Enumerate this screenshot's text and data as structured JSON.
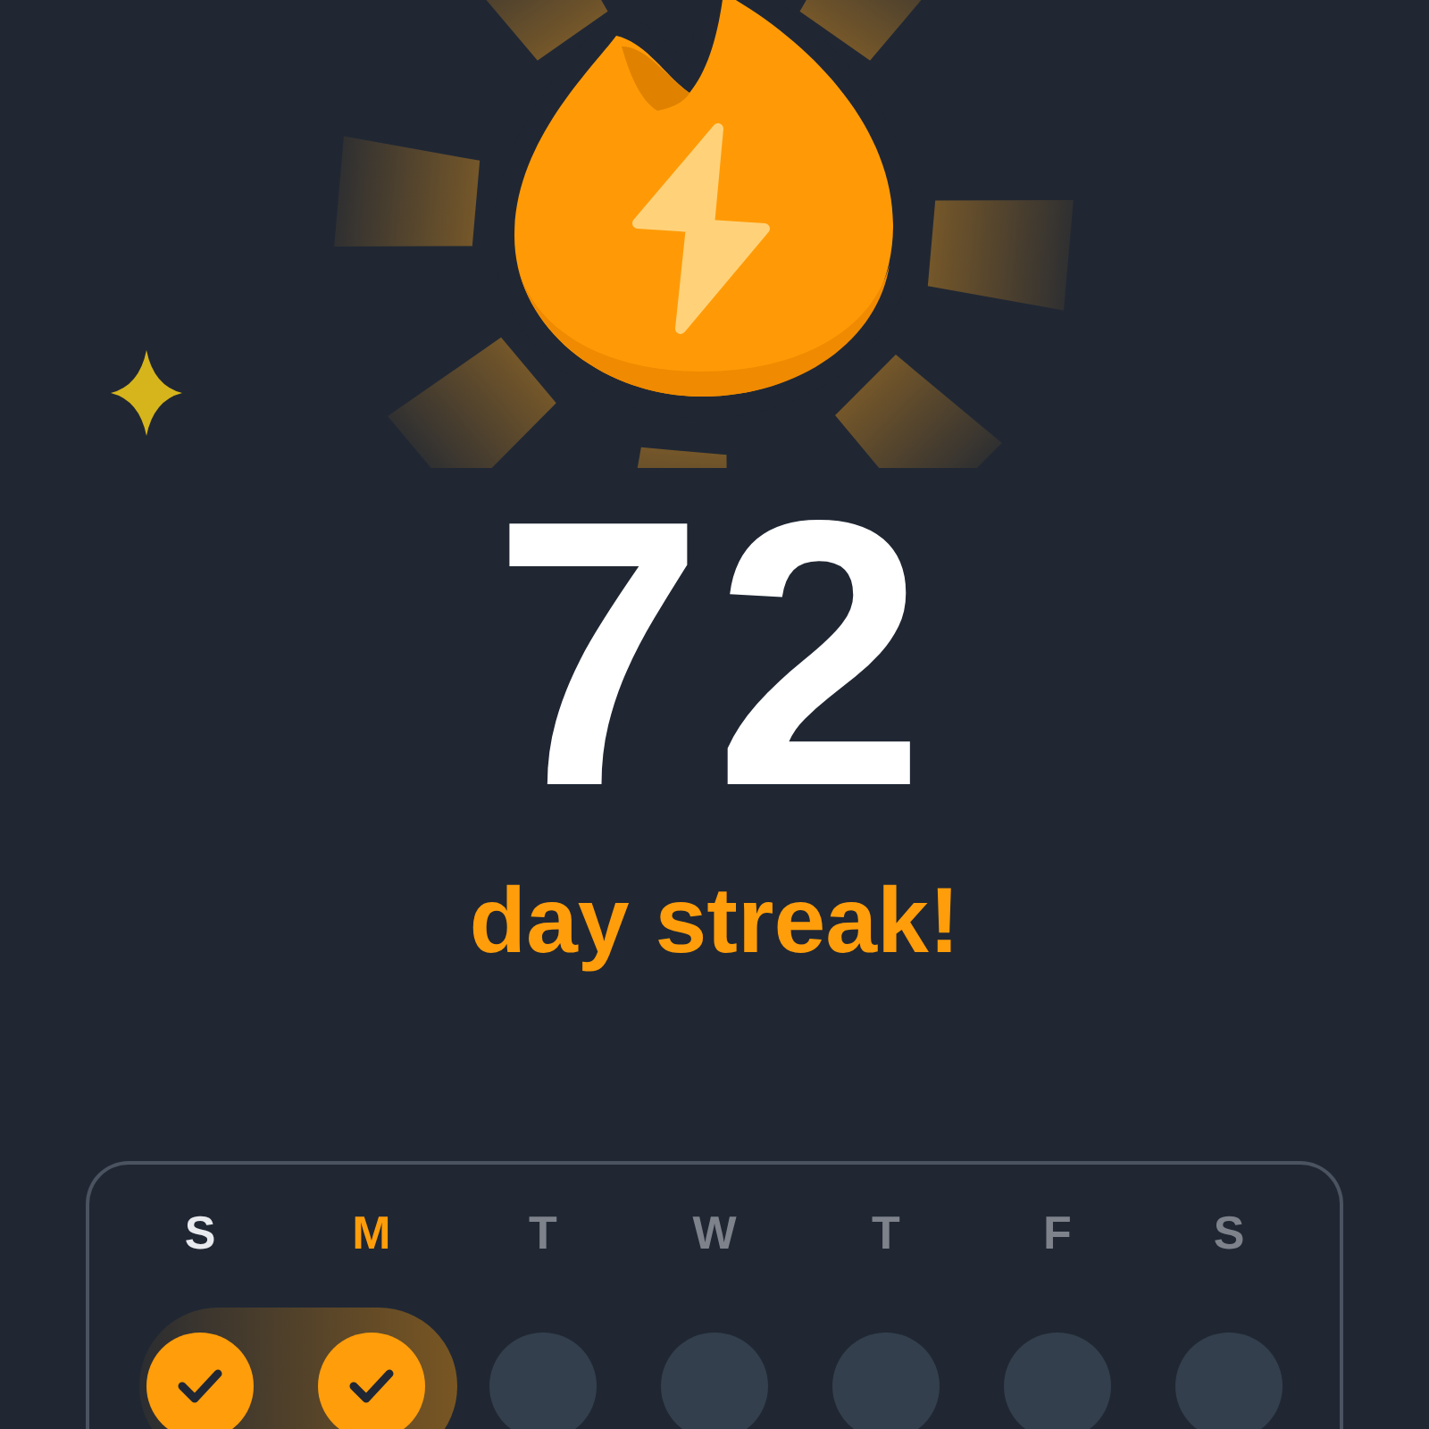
{
  "streak": {
    "count": "72",
    "label": "day streak!"
  },
  "week": {
    "days": [
      {
        "label": "S",
        "done": true,
        "today": false
      },
      {
        "label": "M",
        "done": true,
        "today": true
      },
      {
        "label": "T",
        "done": false,
        "today": false
      },
      {
        "label": "W",
        "done": false,
        "today": false
      },
      {
        "label": "T",
        "done": false,
        "today": false
      },
      {
        "label": "F",
        "done": false,
        "today": false
      },
      {
        "label": "S",
        "done": false,
        "today": false
      }
    ]
  }
}
